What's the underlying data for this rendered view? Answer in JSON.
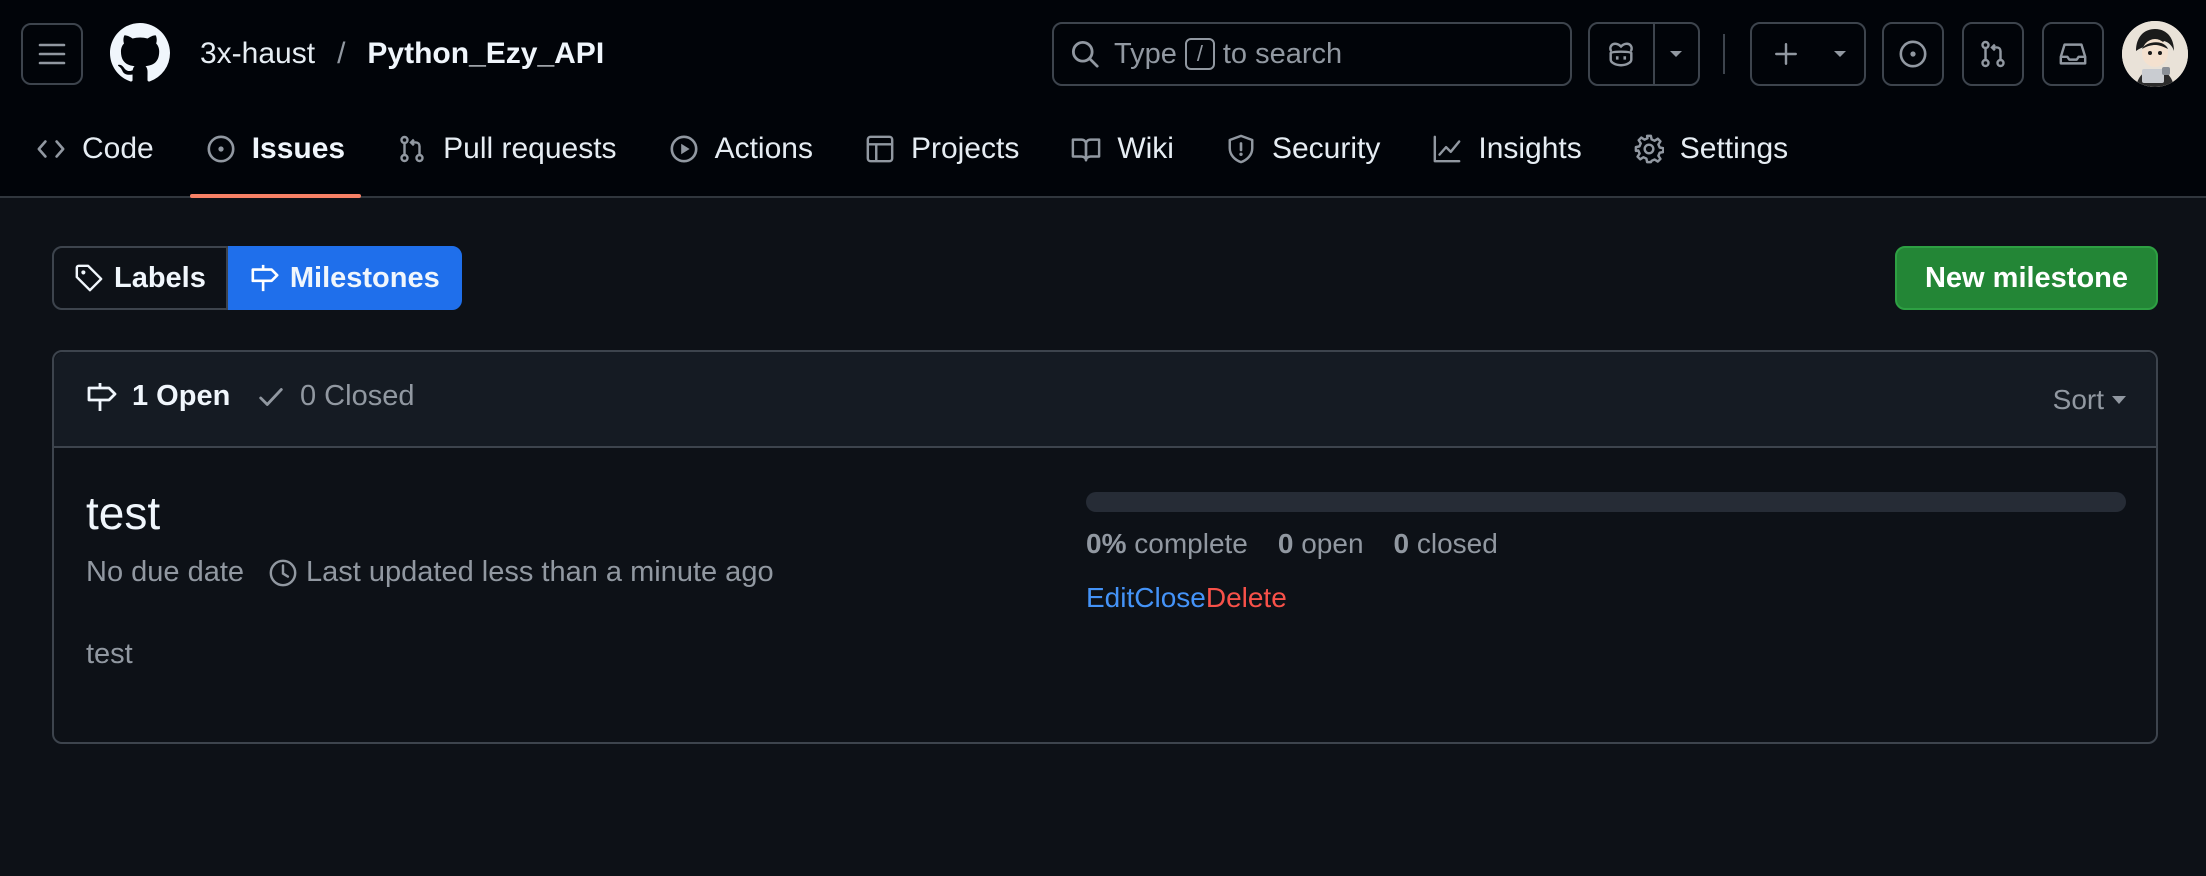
{
  "header": {
    "owner": "3x-haust",
    "separator": "/",
    "repo": "Python_Ezy_API",
    "search": {
      "prefix": "Type",
      "key": "/",
      "suffix": "to search"
    }
  },
  "repo_nav": {
    "tabs": [
      {
        "label": "Code",
        "icon": "code-icon",
        "selected": false
      },
      {
        "label": "Issues",
        "icon": "issue-opened-icon",
        "selected": true
      },
      {
        "label": "Pull requests",
        "icon": "git-pull-request-icon",
        "selected": false
      },
      {
        "label": "Actions",
        "icon": "play-icon",
        "selected": false
      },
      {
        "label": "Projects",
        "icon": "table-icon",
        "selected": false
      },
      {
        "label": "Wiki",
        "icon": "book-icon",
        "selected": false
      },
      {
        "label": "Security",
        "icon": "shield-icon",
        "selected": false
      },
      {
        "label": "Insights",
        "icon": "graph-icon",
        "selected": false
      },
      {
        "label": "Settings",
        "icon": "gear-icon",
        "selected": false
      }
    ]
  },
  "subnav": {
    "labels": "Labels",
    "milestones": "Milestones",
    "new_milestone": "New milestone"
  },
  "milestones": {
    "open_label": "1 Open",
    "closed_label": "0 Closed",
    "sort_label": "Sort",
    "items": [
      {
        "title": "test",
        "due": "No due date",
        "updated": "Last updated less than a minute ago",
        "description": "test",
        "progress_percent": 0,
        "complete_value": "0%",
        "complete_label": "complete",
        "open_value": "0",
        "open_label": "open",
        "closed_value": "0",
        "closed_label": "closed",
        "actions": {
          "edit": "Edit",
          "close": "Close",
          "delete": "Delete"
        }
      }
    ]
  },
  "colors": {
    "background": "#0d1117",
    "header_bg": "#010409",
    "accent_blue": "#1f6feb",
    "primary_green": "#238636",
    "link": "#4493f8",
    "danger": "#f85149",
    "tab_underline": "#f78166"
  }
}
